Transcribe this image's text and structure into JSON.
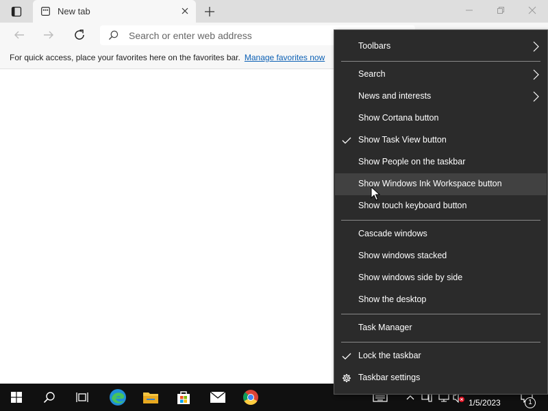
{
  "browser": {
    "tab": {
      "title": "New tab"
    },
    "address": {
      "placeholder": "Search or enter web address"
    },
    "favorites_bar": {
      "message": "For quick access, place your favorites here on the favorites bar.",
      "link": "Manage favorites now"
    }
  },
  "context_menu": {
    "items": [
      {
        "label": "Toolbars",
        "submenu": true
      },
      {
        "label": "Search",
        "submenu": true
      },
      {
        "label": "News and interests",
        "submenu": true
      },
      {
        "label": "Show Cortana button",
        "checked": false
      },
      {
        "label": "Show Task View button",
        "checked": true
      },
      {
        "label": "Show People on the taskbar",
        "checked": false
      },
      {
        "label": "Show Windows Ink Workspace button",
        "checked": false,
        "hovered": true
      },
      {
        "label": "Show touch keyboard button",
        "checked": false
      },
      {
        "label": "Cascade windows"
      },
      {
        "label": "Show windows stacked"
      },
      {
        "label": "Show windows side by side"
      },
      {
        "label": "Show the desktop"
      },
      {
        "label": "Task Manager"
      },
      {
        "label": "Lock the taskbar",
        "checked": true
      },
      {
        "label": "Taskbar settings",
        "icon": "gear-icon"
      }
    ]
  },
  "taskbar": {
    "clock": "1/5/2023",
    "notification_count": "1",
    "apps": [
      "start-icon",
      "search-icon",
      "task-view-icon",
      "edge-icon",
      "file-explorer-icon",
      "store-icon",
      "mail-icon",
      "chrome-icon"
    ]
  },
  "colors": {
    "menu_bg": "#2b2b2b",
    "menu_hover": "#414141",
    "taskbar_bg": "#101010",
    "link": "#0a5fb4"
  }
}
